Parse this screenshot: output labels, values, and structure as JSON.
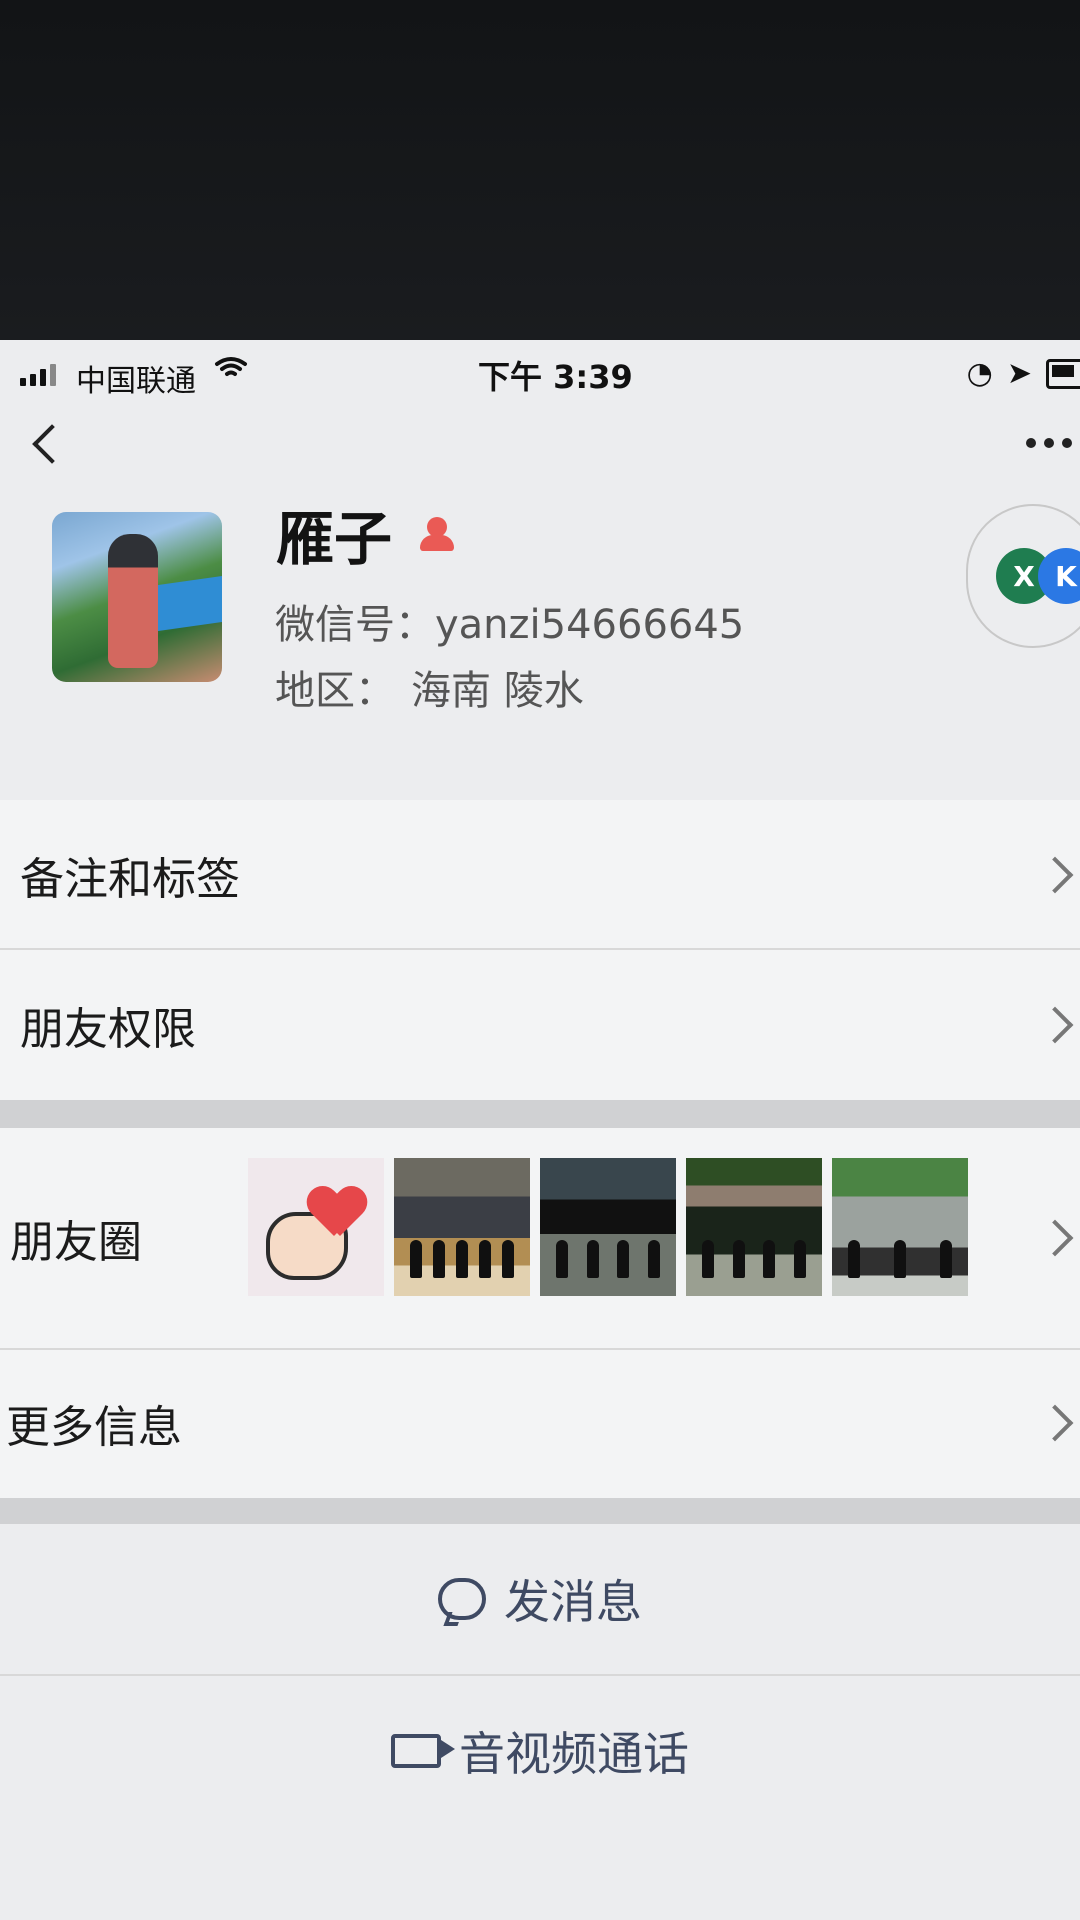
{
  "status_bar": {
    "carrier": "中国联通",
    "time": "下午 3:39"
  },
  "profile": {
    "name": "雁子",
    "wechat_id_label": "微信号：",
    "wechat_id": "yanzi54666645",
    "region_label": "地区：",
    "region_value": "海南 陵水",
    "badge_left": "X",
    "badge_right": "K"
  },
  "rows": {
    "notes_tags": "备注和标签",
    "permissions": "朋友权限",
    "moments": "朋友圈",
    "more_info": "更多信息"
  },
  "actions": {
    "message": "发消息",
    "call": "音视频通话"
  },
  "colors": {
    "accent": "#3f4a63",
    "female": "#ea5a55",
    "background": "#ecedef"
  },
  "icons": [
    "signal-icon",
    "wifi-icon",
    "back-icon",
    "more-icon",
    "female-icon",
    "chevron-right-icon",
    "chat-bubble-icon",
    "video-call-icon"
  ]
}
